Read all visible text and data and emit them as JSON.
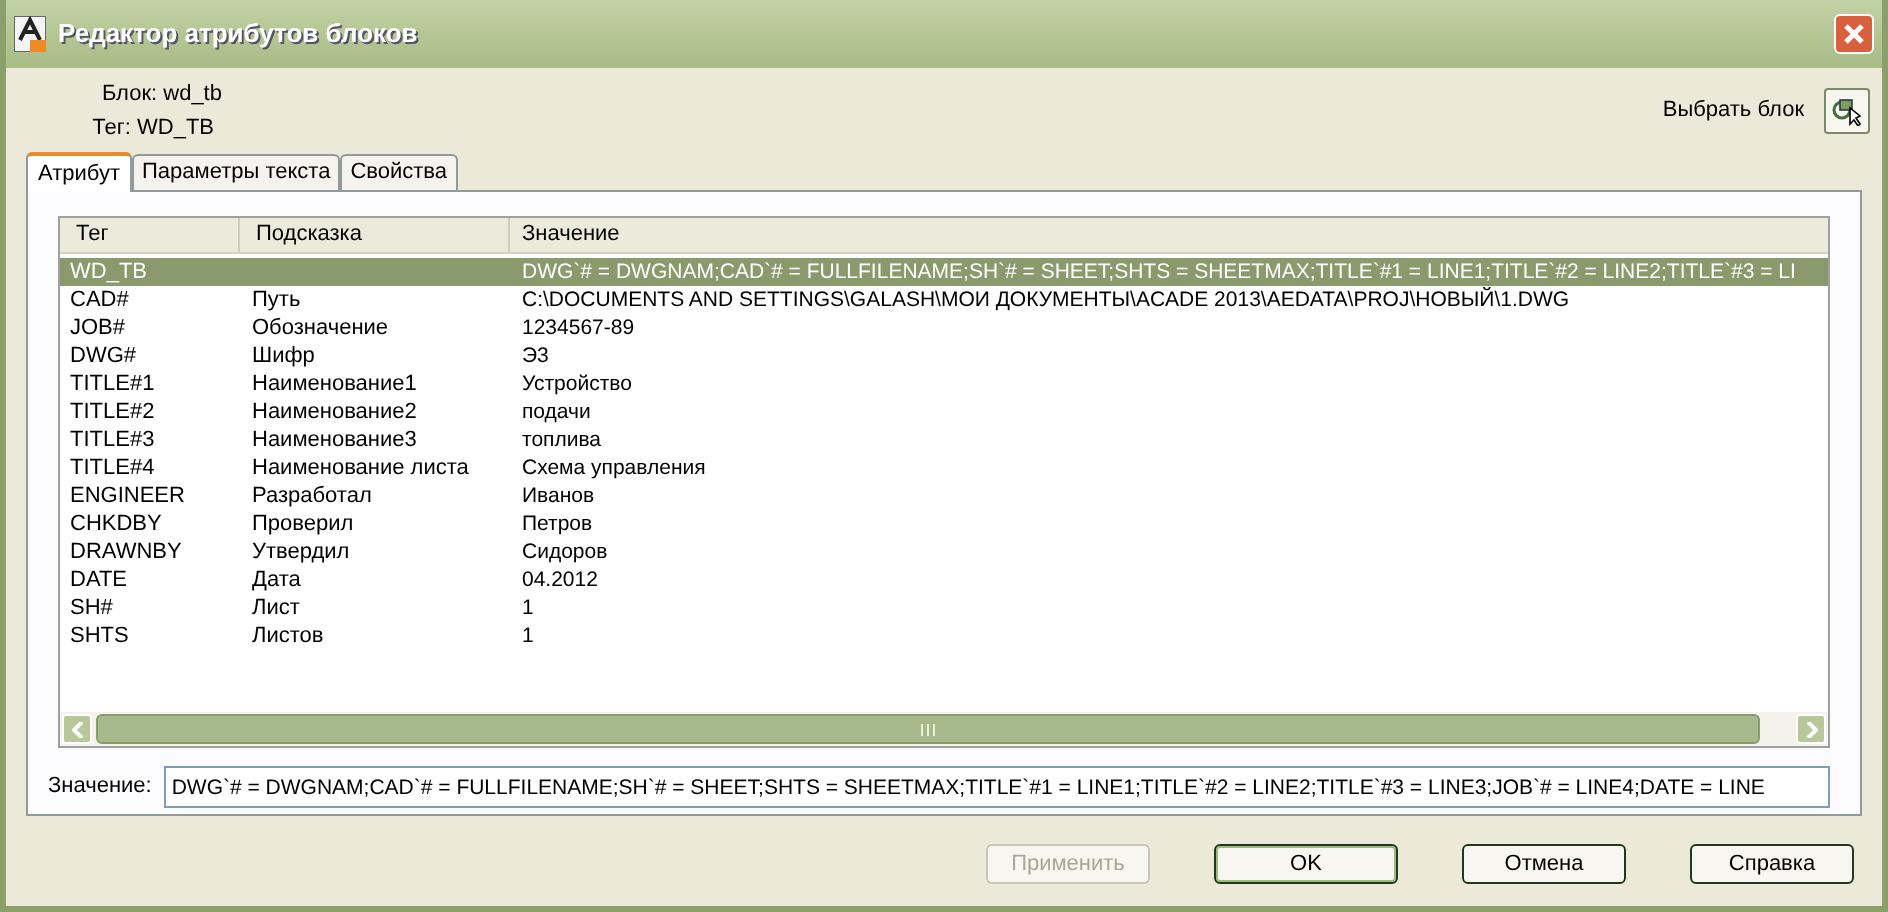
{
  "window": {
    "title": "Редактор атрибутов блоков"
  },
  "block": {
    "block_label": "Блок: wd_tb",
    "tag_label": "Тег: WD_TB"
  },
  "select_block": {
    "label": "Выбрать блок"
  },
  "tabs": [
    {
      "label": "Атрибут",
      "selected": true
    },
    {
      "label": "Параметры текста",
      "selected": false
    },
    {
      "label": "Свойства",
      "selected": false
    }
  ],
  "table": {
    "columns": [
      "Тег",
      "Подсказка",
      "Значение"
    ],
    "rows": [
      {
        "tag": "WD_TB",
        "prompt": "",
        "value": "DWG`# = DWGNAM;CAD`# = FULLFILENAME;SH`# = SHEET;SHTS = SHEETMAX;TITLE`#1 = LINE1;TITLE`#2 = LINE2;TITLE`#3 = LI",
        "selected": true
      },
      {
        "tag": "CAD#",
        "prompt": "Путь",
        "value": "C:\\DOCUMENTS AND SETTINGS\\GALASH\\МОИ ДОКУМЕНТЫ\\ACADE 2013\\AEDATA\\PROJ\\НОВЫЙ\\1.DWG",
        "selected": false
      },
      {
        "tag": "JOB#",
        "prompt": "Обозначение",
        "value": "1234567-89",
        "selected": false
      },
      {
        "tag": "DWG#",
        "prompt": "Шифр",
        "value": "Э3",
        "selected": false
      },
      {
        "tag": "TITLE#1",
        "prompt": "Наименование1",
        "value": "Устройство",
        "selected": false
      },
      {
        "tag": "TITLE#2",
        "prompt": "Наименование2",
        "value": "подачи",
        "selected": false
      },
      {
        "tag": "TITLE#3",
        "prompt": "Наименование3",
        "value": "топлива",
        "selected": false
      },
      {
        "tag": "TITLE#4",
        "prompt": "Наименование листа",
        "value": "Схема управления",
        "selected": false
      },
      {
        "tag": "ENGINEER",
        "prompt": "Разработал",
        "value": "Иванов",
        "selected": false
      },
      {
        "tag": "CHKDBY",
        "prompt": "Проверил",
        "value": "Петров",
        "selected": false
      },
      {
        "tag": "DRAWNBY",
        "prompt": "Утвердил",
        "value": "Сидоров",
        "selected": false
      },
      {
        "tag": "DATE",
        "prompt": "Дата",
        "value": "04.2012",
        "selected": false
      },
      {
        "tag": "SH#",
        "prompt": "Лист",
        "value": "1",
        "selected": false
      },
      {
        "tag": "SHTS",
        "prompt": "Листов",
        "value": "1",
        "selected": false
      }
    ]
  },
  "value_field": {
    "label": "Значение:",
    "value": "DWG`# = DWGNAM;CAD`# = FULLFILENAME;SH`# = SHEET;SHTS = SHEETMAX;TITLE`#1 = LINE1;TITLE`#2 = LINE2;TITLE`#3 = LINE3;JOB`# = LINE4;DATE = LINE"
  },
  "buttons": [
    {
      "label": "Применить",
      "disabled": true,
      "default": false
    },
    {
      "label": "OK",
      "disabled": false,
      "default": true
    },
    {
      "label": "Отмена",
      "disabled": false,
      "default": false
    },
    {
      "label": "Справка",
      "disabled": false,
      "default": false
    }
  ]
}
